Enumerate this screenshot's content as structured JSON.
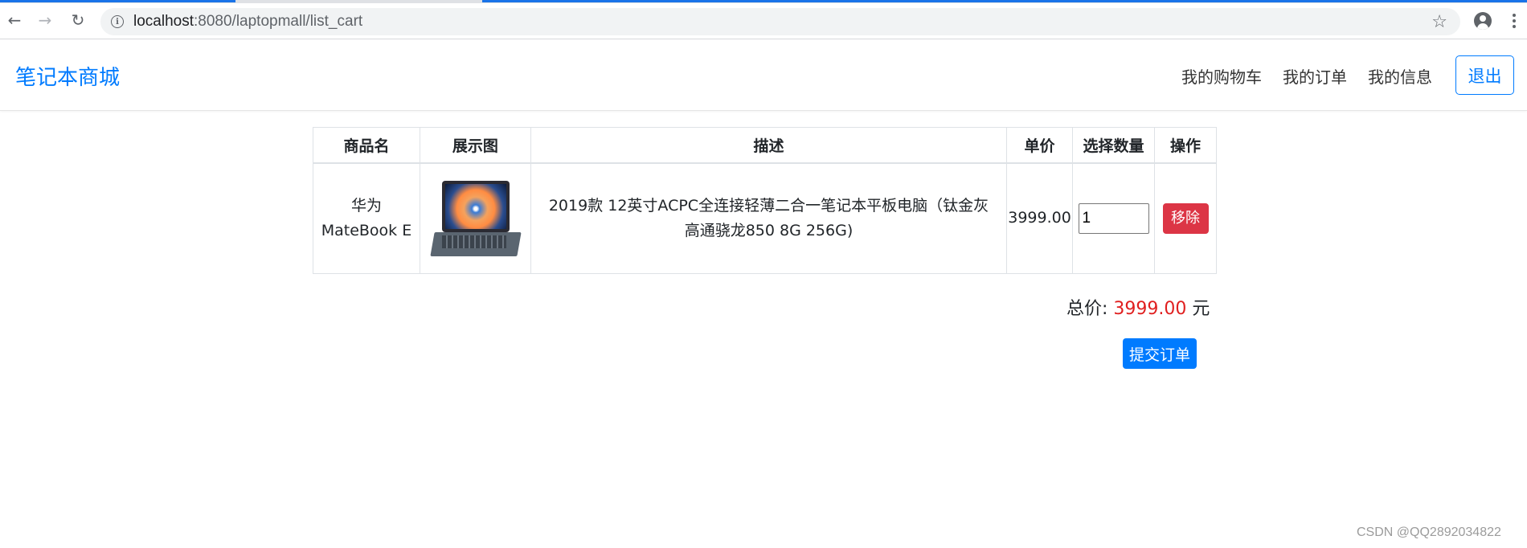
{
  "browser": {
    "url_host": "localhost",
    "url_path": ":8080/laptopmall/list_cart"
  },
  "navbar": {
    "brand": "笔记本商城",
    "links": [
      "我的购物车",
      "我的订单",
      "我的信息"
    ],
    "logout": "退出"
  },
  "cart": {
    "headers": [
      "商品名",
      "展示图",
      "描述",
      "单价",
      "选择数量",
      "操作"
    ],
    "rows": [
      {
        "name_line1": "华为",
        "name_line2": "MateBook E",
        "description_line1": "2019款 12英寸ACPC全连接轻薄二合一笔记本平板电脑（钛金灰",
        "description_line2": "高通骁龙850 8G 256G)",
        "price": "3999.00",
        "quantity": "1",
        "remove_label": "移除"
      }
    ]
  },
  "summary": {
    "total_label": "总价:",
    "total_amount": "3999.00",
    "currency": "元",
    "submit_label": "提交订单"
  },
  "watermark": "CSDN @QQ2892034822",
  "colors": {
    "primary": "#007bff",
    "danger": "#dc3545",
    "price_red": "#e02020"
  }
}
